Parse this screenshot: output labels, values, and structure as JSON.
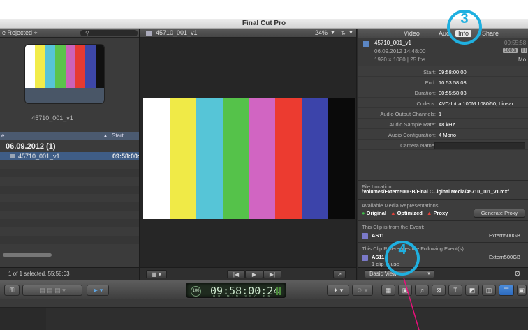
{
  "window": {
    "title": "Final Cut Pro"
  },
  "browser": {
    "filter_label": "e Rejected ÷",
    "search_icon": "search-icon",
    "thumb_title": "45710_001_v1",
    "col_name": "e",
    "col_start": "Start",
    "group_title": "06.09.2012  (1)",
    "clip_name": "45710_001_v1",
    "clip_start": "09:58:00:",
    "status": "1 of 1 selected, 55:58:03",
    "bar_colors": [
      "#ffffff",
      "#f2ec4a",
      "#57c4d8",
      "#5cc34c",
      "#cc62b8",
      "#e63a32",
      "#3d47a8",
      "#111111"
    ]
  },
  "viewer": {
    "title": "45710_001_v1",
    "zoom": "24%",
    "bar_colors": [
      "#ffffff",
      "#f0ea47",
      "#56c5d7",
      "#55c24a",
      "#d165c2",
      "#ec3b30",
      "#3c44aa",
      "#0a0a0a"
    ]
  },
  "inspector": {
    "tabs": [
      "Video",
      "Aud",
      "Info",
      "Share"
    ],
    "active_tab": "Info",
    "clip_name": "45710_001_v1",
    "clip_date": "06.09.2012 14:48:00",
    "clip_format": "1920 × 1080 | 25 fps",
    "clip_duration": "00:55:58",
    "badge_text": "1080i",
    "badge_text2": "H",
    "mode_label": "Mo",
    "props": [
      {
        "key": "Start:",
        "value": "09:58:00:00"
      },
      {
        "key": "End:",
        "value": "10:53:58:03"
      },
      {
        "key": "Duration:",
        "value": "00:55:58:03"
      },
      {
        "key": "Codecs:",
        "value": "AVC-Intra 100M 1080i50, Linear"
      },
      {
        "key": "Audio Output Channels:",
        "value": "1"
      },
      {
        "key": "Audio Sample Rate:",
        "value": "48 kHz"
      },
      {
        "key": "Audio Configuration:",
        "value": "4 Mono"
      },
      {
        "key": "Camera Name:",
        "value": ""
      }
    ],
    "file_location_label": "File Location:",
    "file_location_value": "/Volumes/Extern500GB/Final C...iginal Media/45710_001_v1.mxf",
    "avail_label": "Available Media Representations:",
    "rep_original": "Original",
    "rep_optimized": "Optimized",
    "rep_proxy": "Proxy",
    "gen_proxy": "Generate Proxy",
    "from_event_label": "This Clip is from the Event:",
    "event1_name": "AS11",
    "event1_vol": "Extern500GB",
    "refs_label": "This Clip References the Following Event(s):",
    "event2_name": "AS11",
    "event2_vol": "Extern500GB",
    "event2_sub": "1 clip in use",
    "view_select": "Basic View",
    "colors": {
      "green": "#3fc14a",
      "red": "#e0413a",
      "event": "#7a79c8"
    }
  },
  "toolbar": {
    "timecode": "09:58:00:24",
    "timecode_badge": "100",
    "timecode_sub": "HR MIN SEC FR"
  },
  "callouts": {
    "c3": "3",
    "c4": "4"
  }
}
